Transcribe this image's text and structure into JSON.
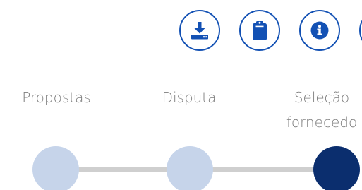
{
  "actions": [
    {
      "name": "download",
      "icon": "download-icon"
    },
    {
      "name": "clipboard",
      "icon": "clipboard-icon"
    },
    {
      "name": "info",
      "icon": "info-icon"
    }
  ],
  "stepper": {
    "steps": [
      {
        "label": "Propostas",
        "state": "done"
      },
      {
        "label": "Disputa",
        "state": "done"
      },
      {
        "label": "Seleção\nfornecedo",
        "state": "current"
      }
    ]
  },
  "colors": {
    "primary": "#1351b4",
    "step_current": "#0b2e6e",
    "step_done": "#c6d4ea",
    "track": "#cfcfcf",
    "label_text": "#7d7d7d"
  }
}
